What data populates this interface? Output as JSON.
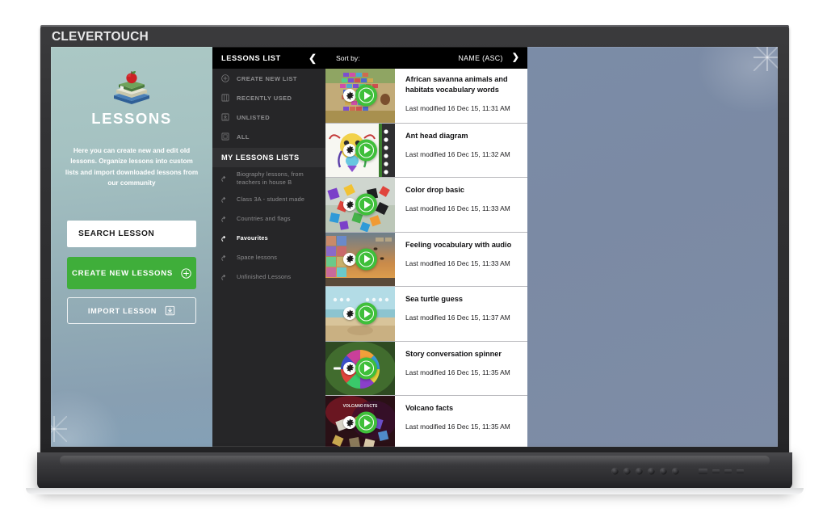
{
  "device": {
    "brand_bold": "CLEVER",
    "brand_light": "TOUCH",
    "brand_full": "CLEVERTOUCH"
  },
  "left_panel": {
    "logo_icon": "stacked-books-apple-icon",
    "title": "LESSONS",
    "description": "Here you can create new and edit old lessons. Organize lessons into custom lists and import downloaded lessons from our community",
    "search_value": "SEARCH LESSON",
    "search_placeholder": "SEARCH LESSON",
    "create_button": "CREATE NEW LESSONS",
    "create_button_icon": "plus-circle-icon",
    "import_button": "IMPORT LESSON",
    "import_button_icon": "download-box-icon",
    "accent_green": "#3fae3a"
  },
  "sidebar": {
    "header": "LESSONS LIST",
    "collapse_icon": "chevron-left-icon",
    "nav_items": [
      {
        "label": "CREATE NEW LIST",
        "icon": "plus-circle-icon"
      },
      {
        "label": "RECENTLY USED",
        "icon": "grid-square-icon"
      },
      {
        "label": "UNLISTED",
        "icon": "download-box-icon"
      },
      {
        "label": "ALL",
        "icon": "square-icon"
      }
    ],
    "section_title": "MY LESSONS LISTS",
    "lists": [
      {
        "label": "Biography lessons, from teachers in house B",
        "icon": "folder-tag-icon",
        "active": false
      },
      {
        "label": "Class 3A - student made",
        "icon": "folder-tag-icon",
        "active": false
      },
      {
        "label": "Countries and flags",
        "icon": "folder-tag-icon",
        "active": false
      },
      {
        "label": "Favourites",
        "icon": "folder-tag-icon",
        "active": true
      },
      {
        "label": "Space lessons",
        "icon": "folder-tag-icon",
        "active": false
      },
      {
        "label": "Unfinished Lessons",
        "icon": "folder-tag-icon",
        "active": false
      }
    ]
  },
  "sortbar": {
    "label": "Sort by:",
    "value": "NAME (ASC)",
    "dropdown_icon": "chevron-down-icon"
  },
  "lessons": [
    {
      "title": "African savanna animals and habitats vocabulary words",
      "modified": "Last modified 16 Dec 15, 11:31 AM",
      "thumb": "savanna-word-tiles",
      "two_line": true
    },
    {
      "title": "Ant head diagram",
      "modified": "Last modified 16 Dec 15, 11:32 AM",
      "thumb": "ant-head-diagram",
      "two_line": false
    },
    {
      "title": "Color drop basic",
      "modified": "Last modified 16 Dec 15, 11:33 AM",
      "thumb": "color-drop-tiles",
      "two_line": false
    },
    {
      "title": "Feeling vocabulary with audio",
      "modified": "Last modified 16 Dec 15, 11:33 AM",
      "thumb": "feeling-faces-sunset",
      "two_line": false
    },
    {
      "title": "Sea turtle guess",
      "modified": "Last modified 16 Dec 15, 11:37 AM",
      "thumb": "sea-turtle-beach",
      "two_line": false
    },
    {
      "title": "Story conversation spinner",
      "modified": "Last modified 16 Dec 15, 11:35 AM",
      "thumb": "color-wheel-spinner",
      "two_line": false
    },
    {
      "title": "Volcano facts",
      "modified": "Last modified 16 Dec 15, 11:35 AM",
      "thumb": "volcano-facts-cards",
      "two_line": false
    }
  ],
  "colors": {
    "bezel": "#2d2d2f",
    "sidebar_bg": "#262628",
    "header_bg": "#000000",
    "right_panel": "#7b8ba5",
    "left_panel_top": "#abc8c5",
    "left_panel_bottom": "#84a0b6",
    "play_green": "#3fbf3a"
  }
}
